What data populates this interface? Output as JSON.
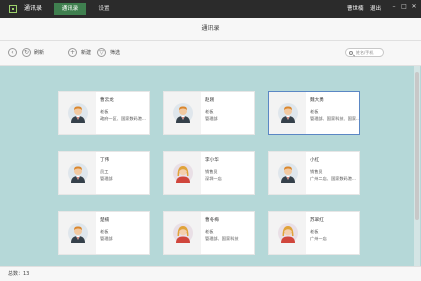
{
  "titlebar": {
    "app_name": "通讯录",
    "tabs": [
      {
        "label": "通讯录",
        "active": true
      },
      {
        "label": "设置",
        "active": false
      }
    ],
    "user": "曹世楠",
    "logout": "退出",
    "controls": {
      "minimize": "–",
      "maximize": "□",
      "close": "✕"
    }
  },
  "page": {
    "title": "通讯录"
  },
  "toolbar": {
    "refresh_label": "刷新",
    "add_label": "新建",
    "filter_label": "筛选",
    "search_placeholder": "姓名/手机"
  },
  "cards": [
    {
      "name": "曹云龙",
      "role": "老板",
      "dept": "政府一区、国家数码港...",
      "gender": "male",
      "selected": false
    },
    {
      "name": "赵刚",
      "role": "老板",
      "dept": "管理部",
      "gender": "male",
      "selected": false
    },
    {
      "name": "魏大勇",
      "role": "老板",
      "dept": "管理部、国家科技、国家...",
      "gender": "male",
      "selected": true
    },
    {
      "name": "丁伟",
      "role": "员工",
      "dept": "管理部",
      "gender": "male",
      "selected": false
    },
    {
      "name": "李小华",
      "role": "销售员",
      "dept": "深圳一店",
      "gender": "female",
      "selected": false
    },
    {
      "name": "小红",
      "role": "销售员",
      "dept": "广州二店、国家数码港...",
      "gender": "male",
      "selected": false
    },
    {
      "name": "楚楠",
      "role": "老板",
      "dept": "管理部",
      "gender": "male",
      "selected": false
    },
    {
      "name": "曹冬梅",
      "role": "老板",
      "dept": "管理部、国家科技",
      "gender": "female",
      "selected": false
    },
    {
      "name": "苏翠红",
      "role": "老板",
      "dept": "广州一店",
      "gender": "female",
      "selected": false
    }
  ],
  "status": {
    "total": "总数：13"
  },
  "colors": {
    "titlebar": "#2b2b2b",
    "active_tab": "#3f7f4f",
    "content_bg": "#b5d8d8",
    "selected_border": "#5b87c4"
  },
  "icons": {
    "back": "back-icon",
    "refresh": "refresh-icon",
    "add": "plus-icon",
    "filter": "filter-icon",
    "search": "search-icon"
  }
}
